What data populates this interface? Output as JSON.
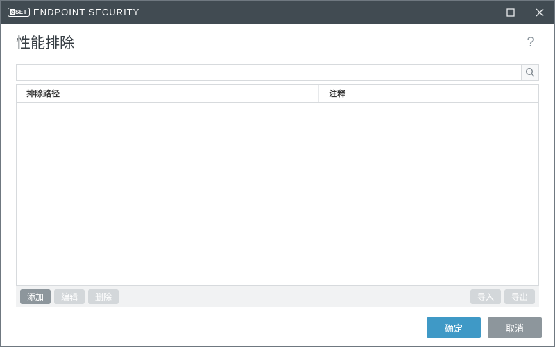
{
  "app_name": "ENDPOINT SECURITY",
  "brand_short": "eset",
  "page_title": "性能排除",
  "help_tooltip": "?",
  "search": {
    "value": "",
    "placeholder": ""
  },
  "columns": {
    "path": "排除路径",
    "comment": "注释"
  },
  "rows": [],
  "actions": {
    "add": "添加",
    "edit": "编辑",
    "delete": "删除",
    "import": "导入",
    "export": "导出"
  },
  "footer": {
    "ok": "确定",
    "cancel": "取消"
  },
  "colors": {
    "accent": "#3f99c6",
    "titlebar": "#414b52"
  }
}
